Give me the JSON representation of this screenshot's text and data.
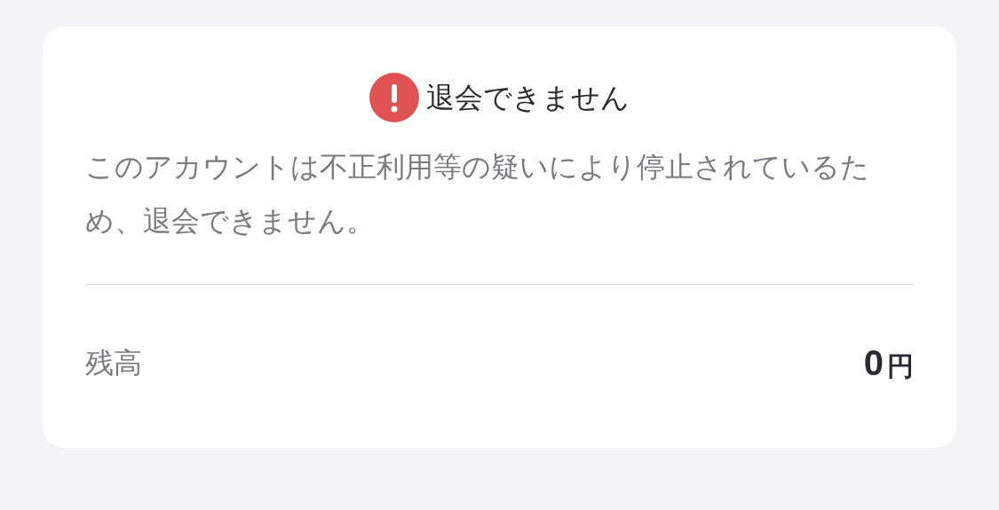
{
  "dialog": {
    "title": "退会できません",
    "message": "このアカウントは不正利用等の疑いにより停止されているため、退会できません。",
    "balance": {
      "label": "残高",
      "amount": "0",
      "unit": "円"
    }
  }
}
